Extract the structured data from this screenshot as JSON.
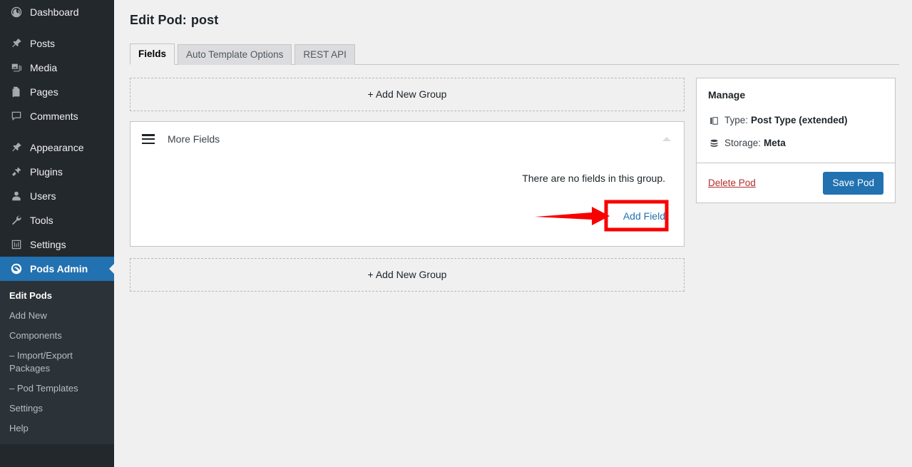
{
  "sidebar": {
    "items": [
      {
        "label": "Dashboard",
        "icon": "dashboard-icon",
        "name": "dashboard",
        "current": false,
        "gap_after": true
      },
      {
        "label": "Posts",
        "icon": "pin-icon",
        "name": "posts",
        "current": false,
        "gap_after": false
      },
      {
        "label": "Media",
        "icon": "media-icon",
        "name": "media",
        "current": false,
        "gap_after": false
      },
      {
        "label": "Pages",
        "icon": "pages-icon",
        "name": "pages",
        "current": false,
        "gap_after": false
      },
      {
        "label": "Comments",
        "icon": "comments-icon",
        "name": "comments",
        "current": false,
        "gap_after": true
      },
      {
        "label": "Appearance",
        "icon": "brush-icon",
        "name": "appearance",
        "current": false,
        "gap_after": false
      },
      {
        "label": "Plugins",
        "icon": "plugins-icon",
        "name": "plugins",
        "current": false,
        "gap_after": false
      },
      {
        "label": "Users",
        "icon": "users-icon",
        "name": "users",
        "current": false,
        "gap_after": false
      },
      {
        "label": "Tools",
        "icon": "wrench-icon",
        "name": "tools",
        "current": false,
        "gap_after": false
      },
      {
        "label": "Settings",
        "icon": "settings-sliders-icon",
        "name": "settings",
        "current": false,
        "gap_after": false
      },
      {
        "label": "Pods Admin",
        "icon": "pods-logo-icon",
        "name": "pods-admin",
        "current": true,
        "gap_after": false
      }
    ],
    "submenu": [
      {
        "label": "Edit Pods",
        "current": true
      },
      {
        "label": "Add New",
        "current": false
      },
      {
        "label": "Components",
        "current": false
      },
      {
        "label": "– Import/Export Packages",
        "current": false
      },
      {
        "label": "– Pod Templates",
        "current": false
      },
      {
        "label": "Settings",
        "current": false
      },
      {
        "label": "Help",
        "current": false
      }
    ],
    "colors": {
      "bg": "#23282d",
      "submenu_bg": "#2c3338",
      "current_bg": "#2271b1"
    }
  },
  "header": {
    "title_prefix": "Edit Pod:",
    "pod_name": "post"
  },
  "tabs": [
    {
      "label": "Fields",
      "active": true
    },
    {
      "label": "Auto Template Options",
      "active": false
    },
    {
      "label": "REST API",
      "active": false
    }
  ],
  "main": {
    "add_group_top_label": "+ Add New Group",
    "add_group_bottom_label": "+ Add New Group",
    "group": {
      "name": "More Fields",
      "empty_message": "There are no fields in this group.",
      "add_field_label": "Add Field",
      "drag_handle_icon": "hamburger-drag-icon",
      "collapse_icon": "triangle-up-icon"
    }
  },
  "manage": {
    "title": "Manage",
    "rows": [
      {
        "icon": "pages-stack-icon",
        "label": "Type:",
        "value": "Post Type (extended)"
      },
      {
        "icon": "database-stack-icon",
        "label": "Storage:",
        "value": "Meta"
      }
    ],
    "delete_label": "Delete Pod",
    "save_label": "Save Pod",
    "colors": {
      "save_bg": "#2271b1",
      "delete_text": "#b32d2e"
    }
  },
  "annotation": {
    "type": "red-arrow-and-box",
    "color": "#f80000",
    "target": "Add Field"
  }
}
